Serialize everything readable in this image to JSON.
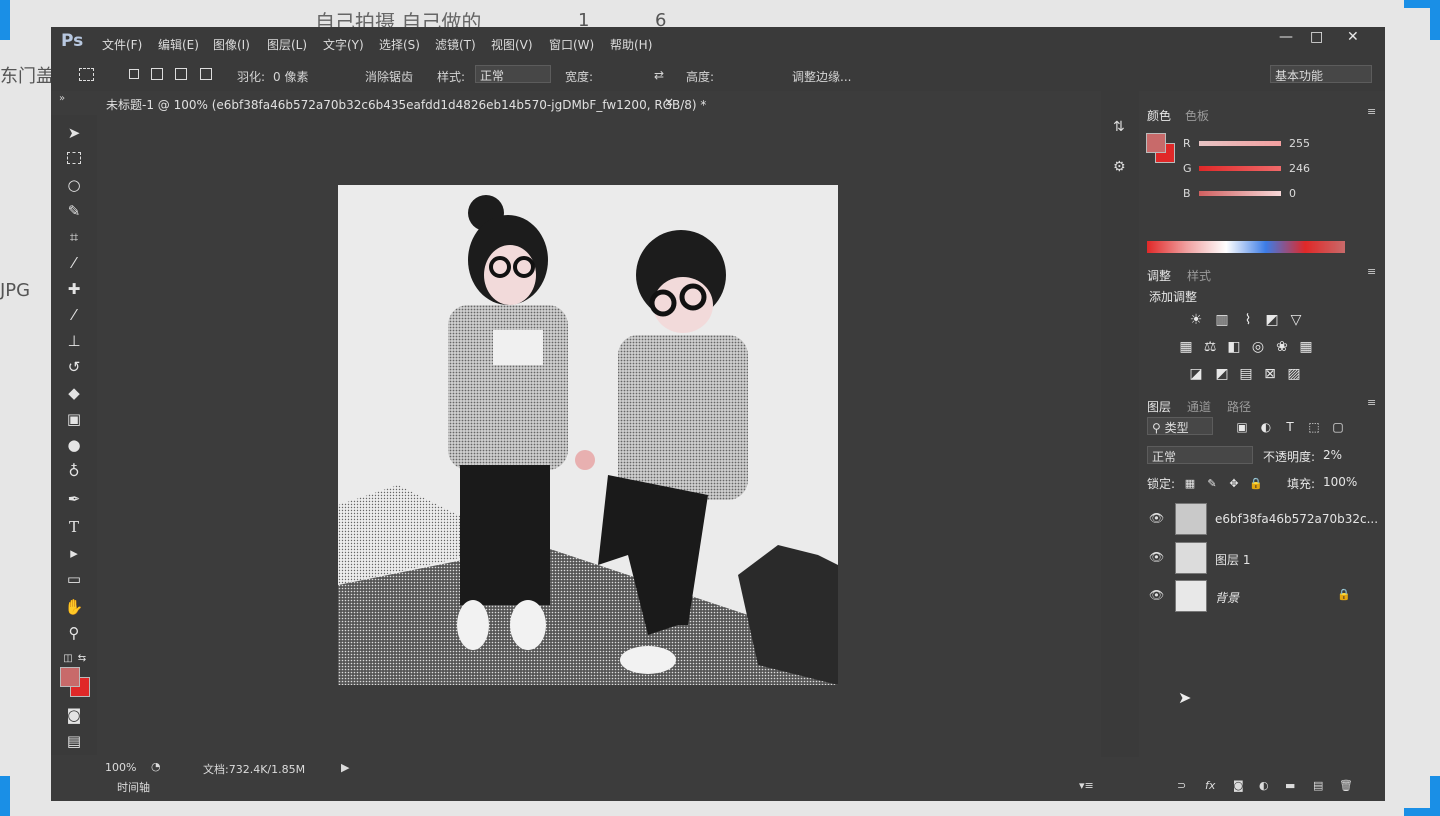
{
  "background": {
    "top_text": "自己拍摄 自己做的",
    "top_nums": [
      "1",
      "6"
    ],
    "left_text_1": "东门盖",
    "left_text_2": "JPG"
  },
  "app": {
    "logo": "Ps",
    "menu": [
      "文件(F)",
      "编辑(E)",
      "图像(I)",
      "图层(L)",
      "文字(Y)",
      "选择(S)",
      "滤镜(T)",
      "视图(V)",
      "窗口(W)",
      "帮助(H)"
    ],
    "window_controls": [
      "—",
      "□",
      "✕"
    ]
  },
  "options": {
    "feather_label": "羽化:",
    "feather_value": "0 像素",
    "antialias_label": "消除锯齿",
    "style_label": "样式:",
    "style_value": "正常",
    "width_label": "宽度:",
    "height_label": "高度:",
    "refine_edge": "调整边缘...",
    "workspace": "基本功能"
  },
  "document": {
    "tab_title": "未标题-1 @ 100% (e6bf38fa46b572a70b32c6b435eafdd1d4826eb14b570-jgDMbF_fw1200, RGB/8) *",
    "close": "×"
  },
  "tools": [
    "move-tool",
    "marquee-tool",
    "lasso-tool",
    "quick-select-tool",
    "crop-tool",
    "eyedropper-tool",
    "healing-brush-tool",
    "brush-tool",
    "clone-stamp-tool",
    "history-brush-tool",
    "eraser-tool",
    "gradient-tool",
    "blur-tool",
    "dodge-tool",
    "pen-tool",
    "type-tool",
    "path-select-tool",
    "shape-tool",
    "hand-tool",
    "zoom-tool"
  ],
  "colors": {
    "foreground": "#c86a6a",
    "background": "#e02828",
    "panel_bg": "#3c3c3c"
  },
  "color_panel": {
    "tab_active": "颜色",
    "tab_inactive": "色板",
    "r_label": "R",
    "g_label": "G",
    "b_label": "B",
    "r_value": "255",
    "g_value": "246",
    "b_value": "0"
  },
  "adjust_panel": {
    "tab_active": "调整",
    "tab_inactive": "样式",
    "add_label": "添加调整"
  },
  "layers_panel": {
    "tab_active": "图层",
    "tab_2": "通道",
    "tab_3": "路径",
    "kind_filter": "类型",
    "blend_mode": "正常",
    "opacity_label": "不透明度:",
    "opacity_value": "2%",
    "lock_label": "锁定:",
    "fill_label": "填充:",
    "fill_value": "100%",
    "layers": [
      {
        "name": "e6bf38fa46b572a70b32c...",
        "visible": true
      },
      {
        "name": "图层 1",
        "visible": true
      },
      {
        "name": "背景",
        "visible": true,
        "locked": true
      }
    ]
  },
  "status": {
    "zoom": "100%",
    "doc_size": "文档:732.4K/1.85M",
    "timeline": "时间轴"
  }
}
